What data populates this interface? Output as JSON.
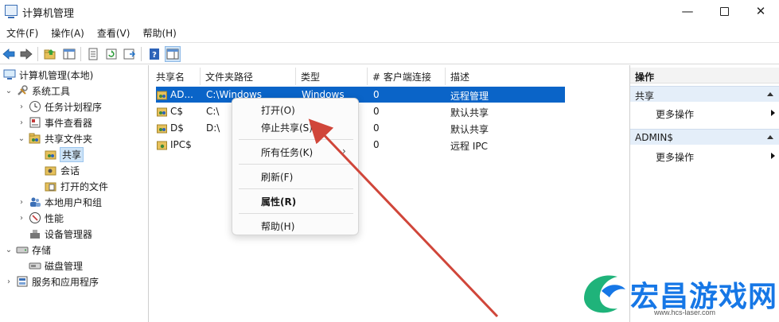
{
  "window": {
    "title": "计算机管理"
  },
  "menu": [
    "文件(F)",
    "操作(A)",
    "查看(V)",
    "帮助(H)"
  ],
  "tree": {
    "items": [
      {
        "label": "计算机管理(本地)"
      },
      {
        "label": "系统工具"
      },
      {
        "label": "任务计划程序"
      },
      {
        "label": "事件查看器"
      },
      {
        "label": "共享文件夹"
      },
      {
        "label": "共享"
      },
      {
        "label": "会话"
      },
      {
        "label": "打开的文件"
      },
      {
        "label": "本地用户和组"
      },
      {
        "label": "性能"
      },
      {
        "label": "设备管理器"
      },
      {
        "label": "存储"
      },
      {
        "label": "磁盘管理"
      },
      {
        "label": "服务和应用程序"
      }
    ]
  },
  "list": {
    "columns": [
      "共享名",
      "文件夹路径",
      "类型",
      "# 客户端连接",
      "描述"
    ],
    "rows": [
      {
        "name": "AD...",
        "path": "C:\\Windows",
        "type": "Windows",
        "clients": "0",
        "desc": "远程管理"
      },
      {
        "name": "C$",
        "path": "C:\\",
        "type": "",
        "clients": "0",
        "desc": "默认共享"
      },
      {
        "name": "D$",
        "path": "D:\\",
        "type": "",
        "clients": "0",
        "desc": "默认共享"
      },
      {
        "name": "IPC$",
        "path": "",
        "type": "",
        "clients": "0",
        "desc": "远程 IPC"
      }
    ]
  },
  "context_menu": {
    "open": "打开(O)",
    "stop_share": "停止共享(S)",
    "all_tasks": "所有任务(K)",
    "refresh": "刷新(F)",
    "properties": "属性(R)",
    "help": "帮助(H)"
  },
  "actions": {
    "title": "操作",
    "section1": "共享",
    "section1_more": "更多操作",
    "section2": "ADMIN$",
    "section2_more": "更多操作"
  },
  "watermark": {
    "text": "宏昌游戏网",
    "url": "www.hcs-laser.com"
  },
  "colors": {
    "selection": "#0a64c8",
    "arrow": "#d0463a",
    "watermark": "#1677e6"
  }
}
